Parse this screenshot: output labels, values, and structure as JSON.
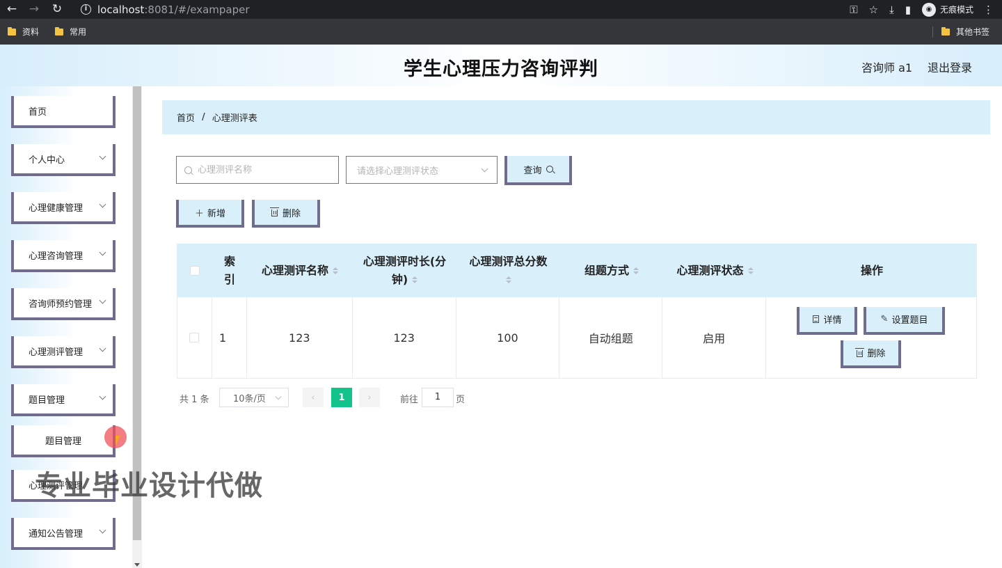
{
  "browser": {
    "url_host": "localhost",
    "url_rest": ":8081/#/exampaper",
    "incognito_label": "无痕模式",
    "bookmarks": [
      "资料",
      "常用"
    ],
    "other_bookmarks": "其他书签"
  },
  "header": {
    "title": "学生心理压力咨询评判",
    "user_label": "咨询师 a1",
    "logout_label": "退出登录"
  },
  "sidebar": {
    "items": [
      {
        "label": "首页"
      },
      {
        "label": "个人中心"
      },
      {
        "label": "心理健康管理"
      },
      {
        "label": "心理咨询管理"
      },
      {
        "label": "咨询师预约管理"
      },
      {
        "label": "心理测评管理"
      },
      {
        "label": "题目管理"
      },
      {
        "label": "题目管理"
      },
      {
        "label": "心理测评管理"
      },
      {
        "label": "通知公告管理"
      }
    ]
  },
  "breadcrumb": {
    "home": "首页",
    "separator": "/",
    "current": "心理测评表"
  },
  "search": {
    "name_placeholder": "心理测评名称",
    "status_placeholder": "请选择心理测评状态",
    "query_label": "查询"
  },
  "actions": {
    "add_label": "新增",
    "delete_label": "删除"
  },
  "table": {
    "headers": {
      "index": "索引",
      "name": "心理测评名称",
      "duration": "心理测评时长(分钟)",
      "total_score": "心理测评总分数",
      "compose_mode": "组题方式",
      "status": "心理测评状态",
      "ops": "操作"
    },
    "rows": [
      {
        "index": "1",
        "name": "123",
        "duration": "123",
        "total_score": "100",
        "compose_mode": "自动组题",
        "status": "启用",
        "detail_label": "详情",
        "set_questions_label": "设置题目",
        "delete_label": "删除"
      }
    ]
  },
  "pagination": {
    "total_text": "共 1 条",
    "page_size": "10条/页",
    "current_page": "1",
    "goto_label": "前往",
    "goto_value": "1",
    "page_unit": "页"
  },
  "overlay": {
    "watermark": "专业毕业设计代做"
  },
  "colors": {
    "accent_light_blue": "#d9f0fb",
    "button_border": "#6f6c8e",
    "pager_active": "#12c38a"
  }
}
